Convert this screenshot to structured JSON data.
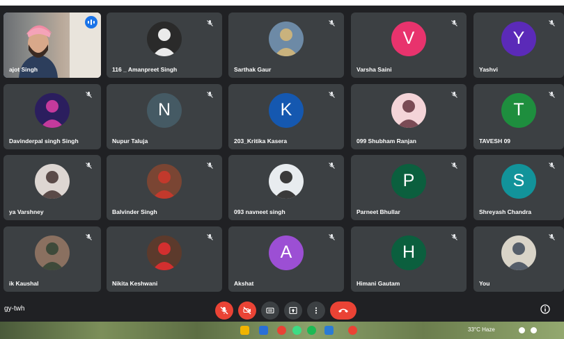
{
  "participants": [
    {
      "name": "ajot Singh",
      "kind": "video"
    },
    {
      "name": "116 _ Amanpreet Singh",
      "kind": "photo"
    },
    {
      "name": "Sarthak Gaur",
      "kind": "photo"
    },
    {
      "name": "Varsha Saini",
      "kind": "initial",
      "initial": "V",
      "color": "#e8336d"
    },
    {
      "name": "Yashvi",
      "kind": "initial",
      "initial": "Y",
      "color": "#5b2ab8"
    },
    {
      "name": "Davinderpal singh Singh",
      "kind": "photo"
    },
    {
      "name": "Nupur Taluja",
      "kind": "initial",
      "initial": "N",
      "color": "#455a64"
    },
    {
      "name": "203_Kritika Kasera",
      "kind": "initial",
      "initial": "K",
      "color": "#1558b0"
    },
    {
      "name": "099 Shubham Ranjan",
      "kind": "photo"
    },
    {
      "name": "TAVESH 09",
      "kind": "initial",
      "initial": "T",
      "color": "#1e8e3e"
    },
    {
      "name": "ya Varshney",
      "kind": "photo"
    },
    {
      "name": "Balvinder Singh",
      "kind": "photo"
    },
    {
      "name": "093 navneet singh",
      "kind": "photo"
    },
    {
      "name": "Parneet Bhullar",
      "kind": "initial",
      "initial": "P",
      "color": "#0b5f3e"
    },
    {
      "name": "Shreyash Chandra",
      "kind": "initial",
      "initial": "S",
      "color": "#12939a"
    },
    {
      "name": "ik Kaushal",
      "kind": "photo"
    },
    {
      "name": "Nikita Keshwani",
      "kind": "photo"
    },
    {
      "name": "Akshat",
      "kind": "initial",
      "initial": "A",
      "color": "#9c4fd4"
    },
    {
      "name": "Himani Gautam",
      "kind": "initial",
      "initial": "H",
      "color": "#0b5f3e"
    },
    {
      "name": "You",
      "kind": "photo"
    }
  ],
  "meeting_code": "gy-twh",
  "controls": [
    "mic-off",
    "camera-off",
    "captions",
    "present-screen",
    "more-options",
    "leave-call"
  ],
  "taskbar": {
    "temperature": "33°C Haze"
  }
}
